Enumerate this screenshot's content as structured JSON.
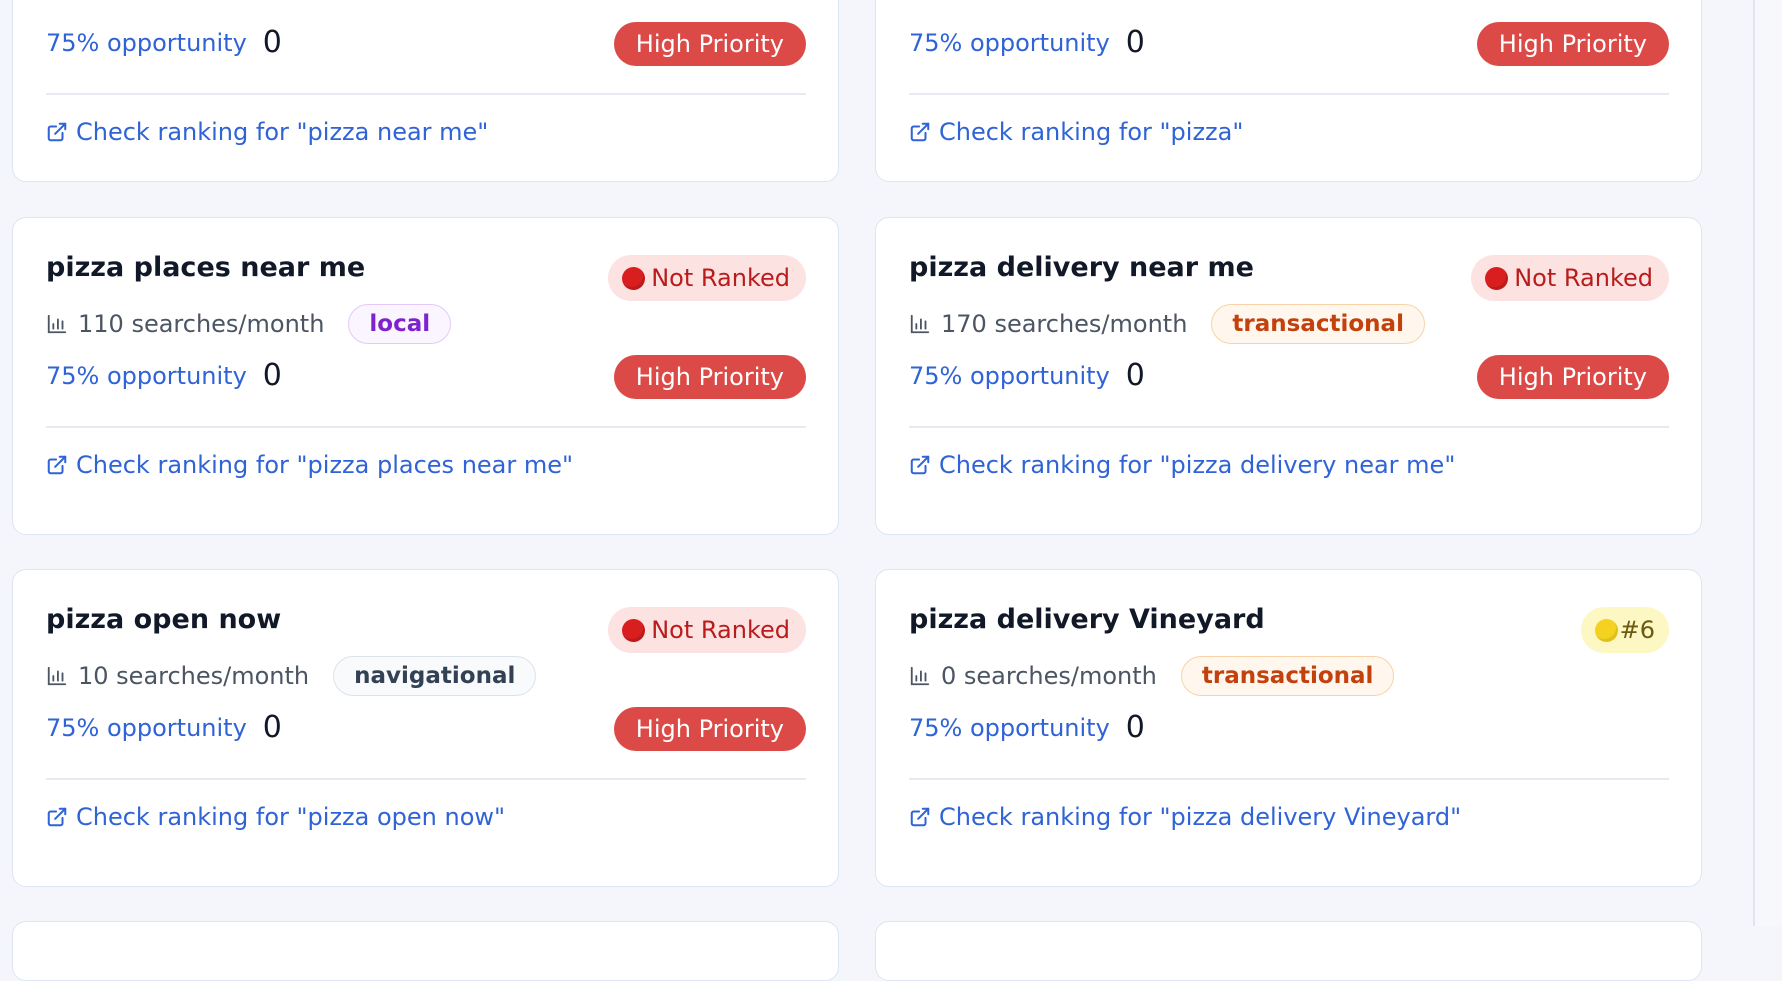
{
  "cards": [
    {
      "title": "",
      "rank_label": "",
      "opportunity": "75% opportunity",
      "score": "0",
      "priority": "High Priority",
      "link": "Check ranking for \"pizza near me\""
    },
    {
      "title": "",
      "rank_label": "",
      "opportunity": "75% opportunity",
      "score": "0",
      "priority": "High Priority",
      "link": "Check ranking for \"pizza\""
    },
    {
      "title": "pizza places near me",
      "rank_label": "Not Ranked",
      "searches": "110 searches/month",
      "tag": "local",
      "opportunity": "75% opportunity",
      "score": "0",
      "priority": "High Priority",
      "link": "Check ranking for \"pizza places near me\""
    },
    {
      "title": "pizza delivery near me",
      "rank_label": "Not Ranked",
      "searches": "170 searches/month",
      "tag": "transactional",
      "opportunity": "75% opportunity",
      "score": "0",
      "priority": "High Priority",
      "link": "Check ranking for \"pizza delivery near me\""
    },
    {
      "title": "pizza open now",
      "rank_label": "Not Ranked",
      "searches": "10 searches/month",
      "tag": "navigational",
      "opportunity": "75% opportunity",
      "score": "0",
      "priority": "High Priority",
      "link": "Check ranking for \"pizza open now\""
    },
    {
      "title": "pizza delivery Vineyard",
      "rank_label": "#6",
      "searches": "0 searches/month",
      "tag": "transactional",
      "opportunity": "75% opportunity",
      "score": "0",
      "priority": "",
      "link": "Check ranking for \"pizza delivery Vineyard\""
    }
  ],
  "colors": {
    "page_bg": "#f4f6fb",
    "link_blue": "#2f63d6",
    "priority_red": "#dc4a47",
    "not_ranked_bg": "#fde2e2",
    "rank_top_bg": "#fdf7c3"
  },
  "icons": {
    "rank_not_ranked": "red-circle-icon",
    "rank_position": "yellow-circle-icon",
    "searches": "bar-chart-icon",
    "link": "external-link-icon"
  }
}
